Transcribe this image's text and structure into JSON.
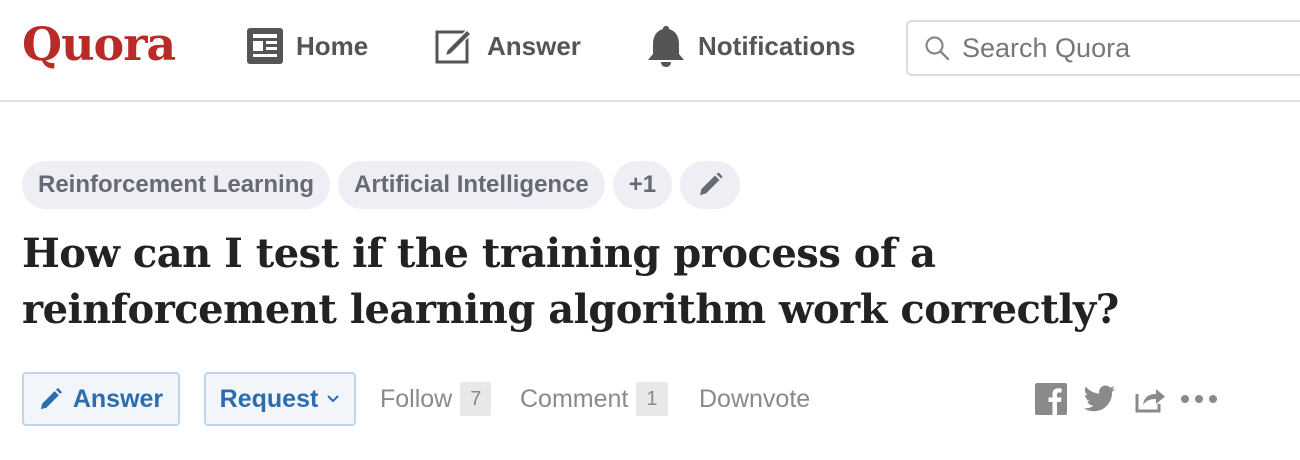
{
  "header": {
    "logo": "Quora",
    "nav": {
      "home": "Home",
      "answer": "Answer",
      "notifications": "Notifications"
    },
    "search": {
      "placeholder": "Search Quora",
      "value": ""
    }
  },
  "question": {
    "topics": [
      "Reinforcement Learning",
      "Artificial Intelligence",
      "+1"
    ],
    "title": "How can I test if the training process of a reinforcement learning algorithm work correctly?",
    "actions": {
      "answer": "Answer",
      "request": "Request",
      "follow": "Follow",
      "follow_count": "7",
      "comment": "Comment",
      "comment_count": "1",
      "downvote": "Downvote"
    },
    "share_icons": [
      "facebook-icon",
      "twitter-icon",
      "share-icon",
      "more-icon"
    ]
  },
  "colors": {
    "brand": "#b92b27",
    "link_blue": "#2b6dad",
    "pill_bg": "#eeeef4",
    "muted": "#8a8a8a"
  }
}
